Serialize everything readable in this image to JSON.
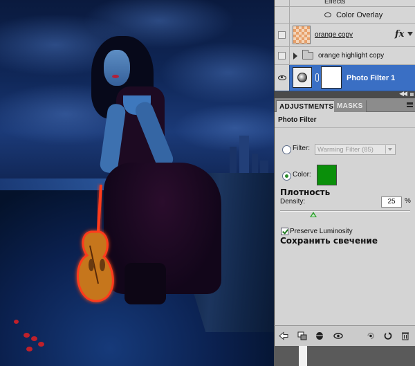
{
  "layers": {
    "effects_label": "Effects",
    "color_overlay_label": "Color Overlay",
    "orange_copy_label": "orange copy",
    "fx_label": "fx",
    "group_label": "orange highlight copy",
    "photo_filter_label": "Photo Filter 1"
  },
  "adjustments": {
    "tab_active": "ADJUSTMENTS",
    "tab_inactive": "MASKS",
    "title": "Photo Filter",
    "filter_label": "Filter:",
    "filter_value": "Warming Filter (85)",
    "color_label": "Color:",
    "color_value": "#0a8f0a",
    "density_ru": "Плотность",
    "density_label": "Density:",
    "density_value": "25",
    "density_unit": "%",
    "preserve_label": "Preserve Luminosity",
    "preserve_checked": true,
    "preserve_ru": "Сохранить свечение"
  },
  "toolbar": {
    "icons": [
      "back-arrow-icon",
      "clip-layer-icon",
      "mask-visibility-icon",
      "eye-icon",
      "previous-state-icon",
      "reset-icon",
      "trash-icon"
    ]
  }
}
